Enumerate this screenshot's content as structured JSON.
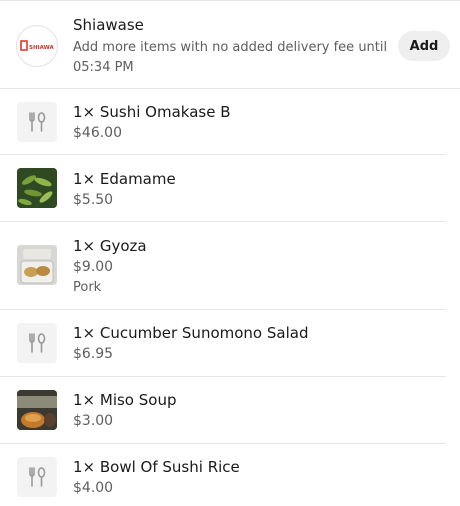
{
  "store": {
    "name": "Shiawase",
    "note": "Add more items with no added delivery fee until 05:34 PM",
    "add_label": "Add",
    "logo_text": "SHIAWASE"
  },
  "items": [
    {
      "title": "1× Sushi Omakase B",
      "price": "$46.00",
      "thumb": "utensils-icon"
    },
    {
      "title": "1× Edamame",
      "price": "$5.50",
      "thumb": "edamame-photo"
    },
    {
      "title": "1× Gyoza",
      "price": "$9.00",
      "option": "Pork",
      "thumb": "gyoza-photo"
    },
    {
      "title": "1× Cucumber Sunomono Salad",
      "price": "$6.95",
      "thumb": "utensils-icon"
    },
    {
      "title": "1× Miso Soup",
      "price": "$3.00",
      "thumb": "miso-soup-photo"
    },
    {
      "title": "1× Bowl Of Sushi Rice",
      "price": "$4.00",
      "thumb": "utensils-icon"
    }
  ],
  "colors": {
    "primary_text": "#1a1a1a",
    "secondary_text": "#5e5e5e",
    "button_bg": "#efefef",
    "divider": "#e6e6e6"
  }
}
